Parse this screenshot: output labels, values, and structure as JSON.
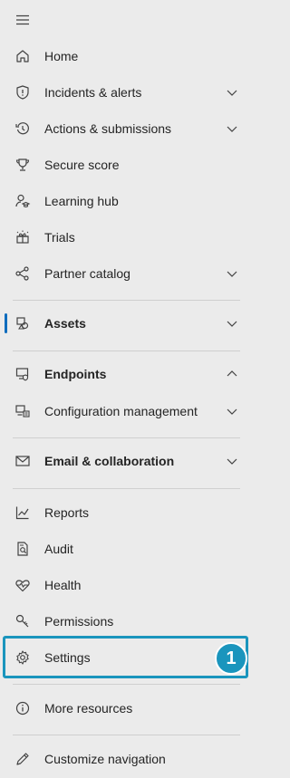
{
  "colors": {
    "background": "#ebebeb",
    "text": "#242424",
    "divider": "#cfcfcf",
    "active_indicator": "#0f6cbd",
    "highlight": "#1a95bd"
  },
  "nav": {
    "menu_icon": "hamburger-icon",
    "home": "Home",
    "incidents_alerts": "Incidents & alerts",
    "actions_submissions": "Actions & submissions",
    "secure_score": "Secure score",
    "learning_hub": "Learning hub",
    "trials": "Trials",
    "partner_catalog": "Partner catalog",
    "assets": "Assets",
    "endpoints": "Endpoints",
    "configuration_management": "Configuration management",
    "email_collaboration": "Email & collaboration",
    "reports": "Reports",
    "audit": "Audit",
    "health": "Health",
    "permissions": "Permissions",
    "settings": "Settings",
    "more_resources": "More resources",
    "customize_navigation": "Customize navigation"
  },
  "callout": {
    "number": "1"
  }
}
